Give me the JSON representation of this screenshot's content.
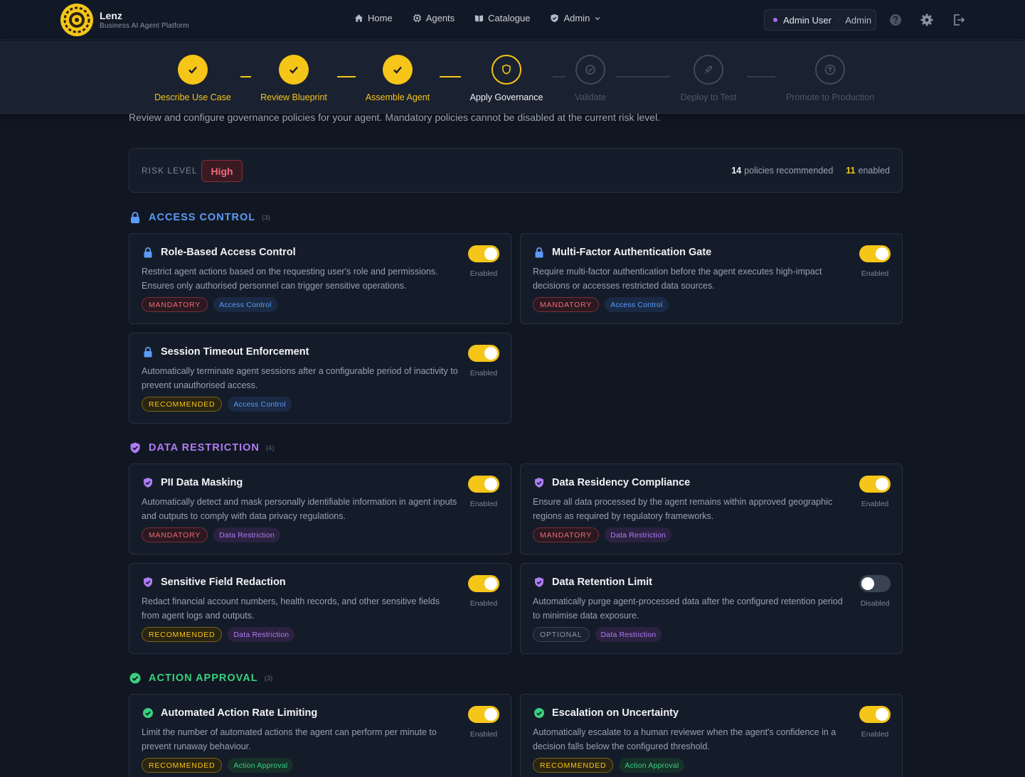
{
  "header": {
    "brand": "Lenz",
    "subtitle": "Business AI Agent Platform",
    "nav": [
      {
        "label": "Home",
        "icon": "home-icon"
      },
      {
        "label": "Agents",
        "icon": "chip-icon"
      },
      {
        "label": "Catalogue",
        "icon": "book-icon"
      },
      {
        "label": "Admin",
        "icon": "shield-icon"
      }
    ],
    "user": {
      "name": "Admin User",
      "separator": "·",
      "role": "Admin",
      "dot_color": "#a66cf0"
    },
    "icons": [
      "help-icon",
      "gear-icon",
      "logout-icon"
    ]
  },
  "stepper": [
    {
      "label": "Describe Use Case",
      "state": "done"
    },
    {
      "label": "Review Blueprint",
      "state": "done"
    },
    {
      "label": "Assemble Agent",
      "state": "done"
    },
    {
      "label": "Apply Governance",
      "state": "active"
    },
    {
      "label": "Validate",
      "state": "todo"
    },
    {
      "label": "Deploy to Test",
      "state": "todo"
    },
    {
      "label": "Promote to Production",
      "state": "todo"
    }
  ],
  "intro": "Review and configure governance policies for your agent. Mandatory policies cannot be disabled at the current risk level.",
  "risk": {
    "label": "RISK LEVEL",
    "level": "High",
    "recommended_count": "14",
    "recommended_text": "policies recommended",
    "enabled_count": "11",
    "enabled_text": "enabled"
  },
  "sections": [
    {
      "title": "ACCESS CONTROL",
      "count": "(3)",
      "color": "#5b9bf7",
      "icon": "lock-icon",
      "policies": [
        {
          "title": "Role-Based Access Control",
          "desc": "Restrict agent actions based on the requesting user's role and permissions. Ensures only authorised personnel can trigger sensitive operations.",
          "level": "MANDATORY",
          "category": "Access Control",
          "enabled": true,
          "state": "Enabled"
        },
        {
          "title": "Multi-Factor Authentication Gate",
          "desc": "Require multi-factor authentication before the agent executes high-impact decisions or accesses restricted data sources.",
          "level": "MANDATORY",
          "category": "Access Control",
          "enabled": true,
          "state": "Enabled"
        },
        {
          "title": "Session Timeout Enforcement",
          "desc": "Automatically terminate agent sessions after a configurable period of inactivity to prevent unauthorised access.",
          "level": "RECOMMENDED",
          "category": "Access Control",
          "enabled": true,
          "state": "Enabled"
        }
      ]
    },
    {
      "title": "DATA RESTRICTION",
      "count": "(4)",
      "color": "#b07cf5",
      "icon": "shield-check-icon",
      "policies": [
        {
          "title": "PII Data Masking",
          "desc": "Automatically detect and mask personally identifiable information in agent inputs and outputs to comply with data privacy regulations.",
          "level": "MANDATORY",
          "category": "Data Restriction",
          "enabled": true,
          "state": "Enabled"
        },
        {
          "title": "Data Residency Compliance",
          "desc": "Ensure all data processed by the agent remains within approved geographic regions as required by regulatory frameworks.",
          "level": "MANDATORY",
          "category": "Data Restriction",
          "enabled": true,
          "state": "Enabled"
        },
        {
          "title": "Sensitive Field Redaction",
          "desc": "Redact financial account numbers, health records, and other sensitive fields from agent logs and outputs.",
          "level": "RECOMMENDED",
          "category": "Data Restriction",
          "enabled": true,
          "state": "Enabled"
        },
        {
          "title": "Data Retention Limit",
          "desc": "Automatically purge agent-processed data after the configured retention period to minimise data exposure.",
          "level": "OPTIONAL",
          "category": "Data Restriction",
          "enabled": false,
          "state": "Disabled"
        }
      ]
    },
    {
      "title": "ACTION APPROVAL",
      "count": "(3)",
      "color": "#39d07e",
      "icon": "check-circle-icon",
      "policies": [
        {
          "title": "Automated Action Rate Limiting",
          "desc": "Limit the number of automated actions the agent can perform per minute to prevent runaway behaviour.",
          "level": "RECOMMENDED",
          "category": "Action Approval",
          "enabled": true,
          "state": "Enabled"
        },
        {
          "title": "Escalation on Uncertainty",
          "desc": "Automatically escalate to a human reviewer when the agent's confidence in a decision falls below the configured threshold.",
          "level": "RECOMMENDED",
          "category": "Action Approval",
          "enabled": true,
          "state": "Enabled"
        }
      ]
    }
  ]
}
